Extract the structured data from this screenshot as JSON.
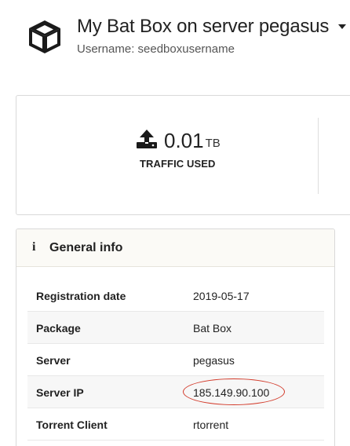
{
  "header": {
    "title": "My Bat Box on server pegasus",
    "username_label": "Username: seedboxusername",
    "icon": "box-icon",
    "dropdown_icon": "caret-down-icon"
  },
  "traffic": {
    "icon": "upload-icon",
    "value": "0.01",
    "unit": "TB",
    "label": "TRAFFIC USED"
  },
  "general_info": {
    "icon": "info-icon",
    "icon_glyph": "i",
    "title": "General info",
    "rows": [
      {
        "key": "Registration date",
        "value": "2019-05-17"
      },
      {
        "key": "Package",
        "value": "Bat Box"
      },
      {
        "key": "Server",
        "value": "pegasus"
      },
      {
        "key": "Server IP",
        "value": "185.149.90.100"
      },
      {
        "key": "Torrent Client",
        "value": "rtorrent"
      }
    ]
  },
  "colors": {
    "highlight": "#d23a2a",
    "header_bg": "#fbfaf6",
    "row_shaded": "#f7f7f7"
  }
}
